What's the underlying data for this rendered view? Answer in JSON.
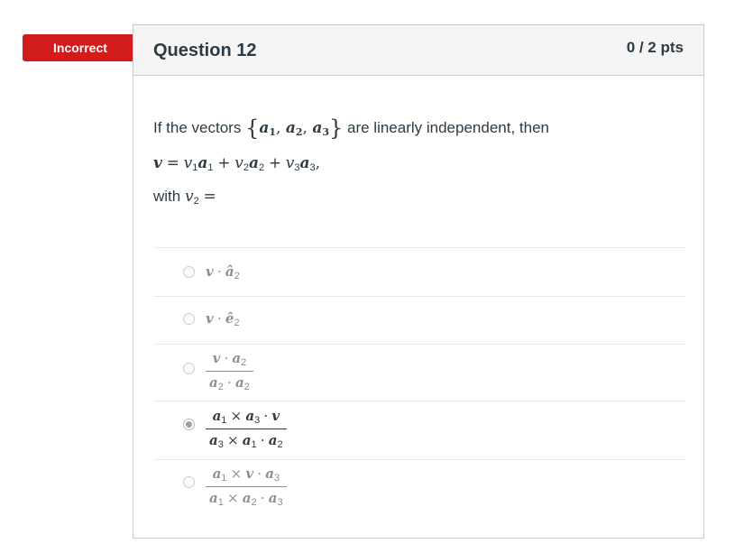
{
  "status_badge": "Incorrect",
  "question": {
    "title": "Question 12",
    "points": "0 / 2 pts",
    "text_before": "If the vectors",
    "text_after": "are linearly independent, then",
    "with_label": "with"
  },
  "math": {
    "vector_set": [
      "a",
      "a",
      "a"
    ],
    "vector_set_subscripts": [
      "1",
      "2",
      "3"
    ],
    "equation_lhs": "v",
    "equation_terms": [
      "v₁a₁",
      "v₂a₂",
      "v₃a₃"
    ],
    "with_var": "v₂"
  },
  "answers": [
    {
      "text": "v · â₂",
      "selected": false
    },
    {
      "text": "v · ê₂",
      "selected": false
    },
    {
      "numerator": "v · a₂",
      "denominator": "a₂ · a₂",
      "selected": false
    },
    {
      "numerator": "a₁ × a₃ · v",
      "denominator": "a₃ × a₁ · a₂",
      "selected": true
    },
    {
      "numerator": "a₁ × v · a₃",
      "denominator": "a₁ × a₂ · a₃",
      "selected": false
    }
  ]
}
